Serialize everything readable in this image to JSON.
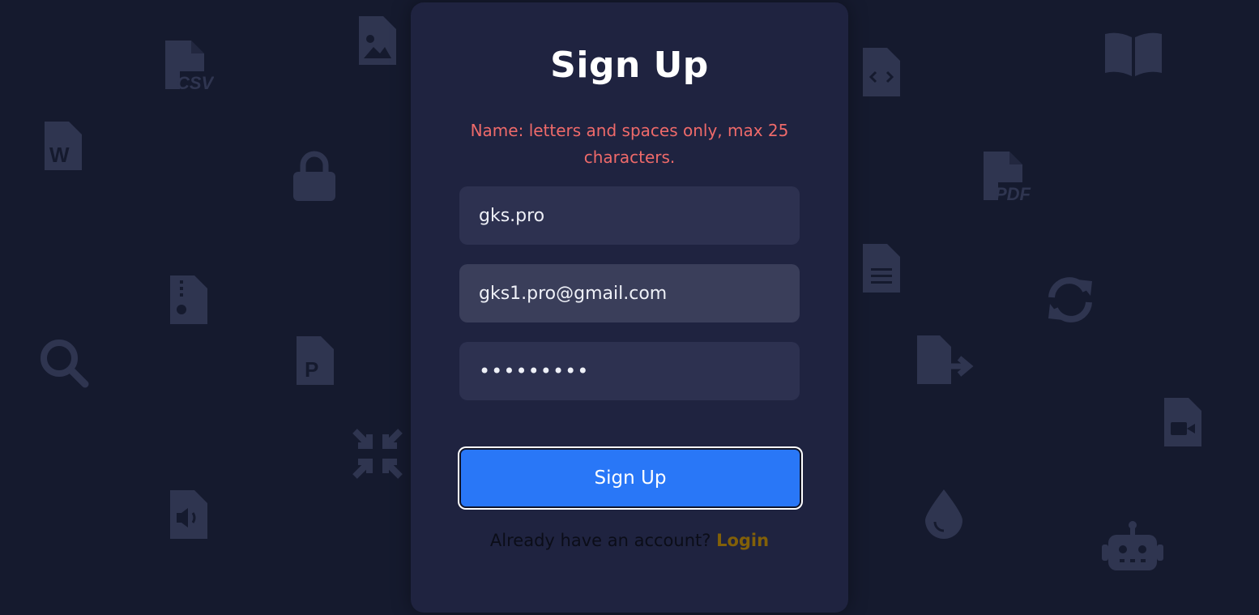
{
  "form": {
    "title": "Sign Up",
    "error_message": "Name: letters and spaces only, max 25 characters.",
    "name_value": "gks.pro",
    "email_value": "gks1.pro@gmail.com",
    "password_masked": "•••••••••",
    "submit_label": "Sign Up",
    "footer_text": "Already have an account?",
    "login_link": "Login"
  },
  "colors": {
    "background": "#151a2e",
    "card": "#1f2340",
    "accent": "#2977f7",
    "error": "#ef6a6a",
    "link": "#826008"
  },
  "background_icons": [
    {
      "name": "csv-file-icon",
      "label": "CSV"
    },
    {
      "name": "image-file-icon"
    },
    {
      "name": "word-file-icon",
      "label": "W"
    },
    {
      "name": "lock-icon"
    },
    {
      "name": "zip-file-icon"
    },
    {
      "name": "search-icon"
    },
    {
      "name": "powerpoint-file-icon",
      "label": "P"
    },
    {
      "name": "compress-icon"
    },
    {
      "name": "audio-file-icon"
    },
    {
      "name": "code-file-icon"
    },
    {
      "name": "book-icon"
    },
    {
      "name": "pdf-file-icon",
      "label": "PDF"
    },
    {
      "name": "text-file-icon"
    },
    {
      "name": "sync-icon"
    },
    {
      "name": "file-export-icon"
    },
    {
      "name": "video-file-icon"
    },
    {
      "name": "droplet-icon"
    },
    {
      "name": "robot-icon"
    }
  ]
}
